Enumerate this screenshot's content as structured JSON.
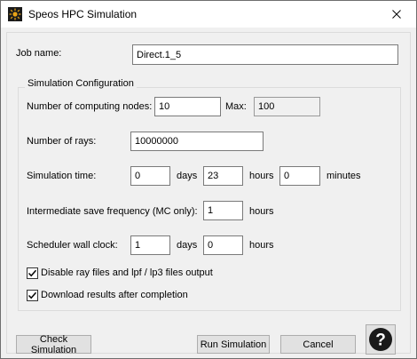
{
  "window": {
    "title": "Speos HPC Simulation",
    "app_icon": "sun-icon",
    "close_icon": "close-icon"
  },
  "job": {
    "label": "Job name:",
    "value": "Direct.1_5"
  },
  "config": {
    "title": "Simulation Configuration",
    "nodes_label": "Number of computing nodes:",
    "nodes_value": "10",
    "max_label": "Max:",
    "max_value": "100",
    "rays_label": "Number of rays:",
    "rays_value": "10000000",
    "time_label": "Simulation time:",
    "time_days_value": "0",
    "time_days_unit": "days",
    "time_hours_value": "23",
    "time_hours_unit": "hours",
    "time_minutes_value": "0",
    "time_minutes_unit": "minutes",
    "save_label": "Intermediate save frequency (MC only):",
    "save_value": "1",
    "save_unit": "hours",
    "wall_label": "Scheduler wall clock:",
    "wall_days_value": "1",
    "wall_days_unit": "days",
    "wall_hours_value": "0",
    "wall_hours_unit": "hours",
    "disable_ray_files_label": "Disable ray files and lpf / lp3 files output",
    "disable_ray_files_checked": true,
    "download_results_label": "Download results after completion",
    "download_results_checked": true
  },
  "buttons": {
    "check": "Check Simulation",
    "run": "Run Simulation",
    "cancel": "Cancel",
    "help_icon": "question-icon"
  }
}
